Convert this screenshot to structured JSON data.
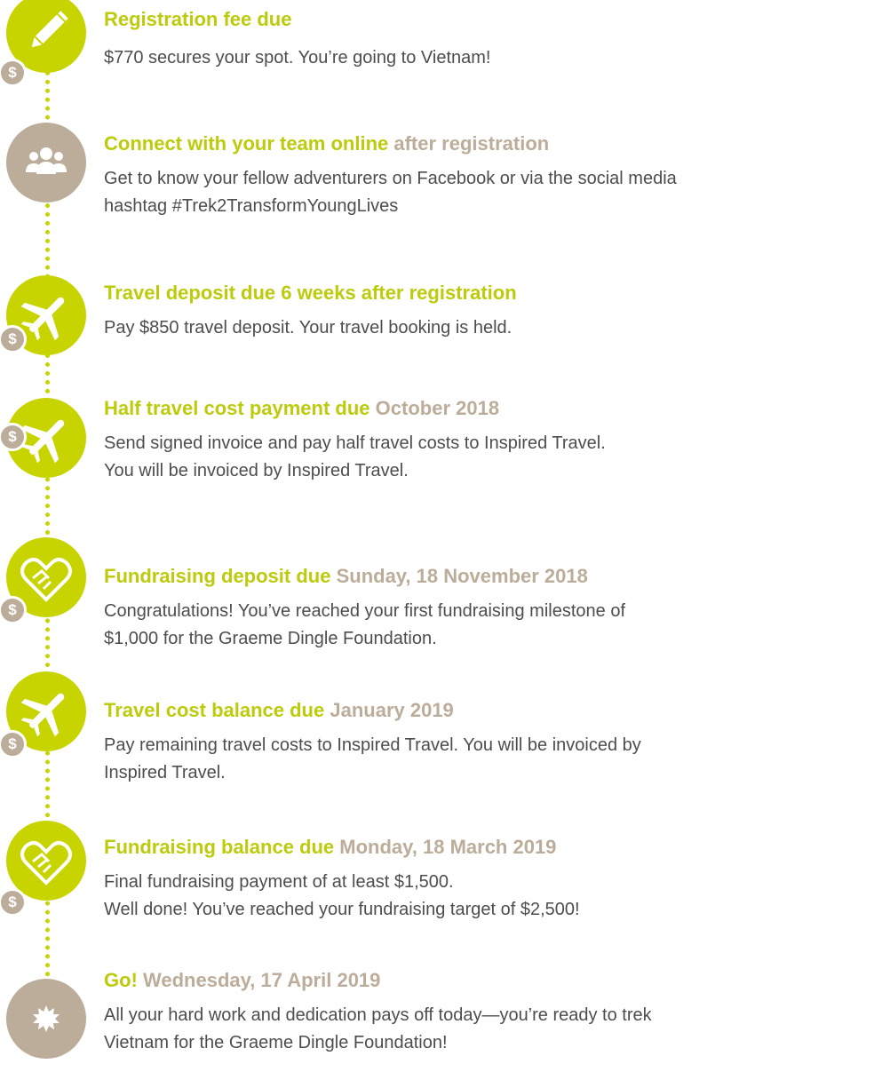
{
  "colors": {
    "accent": "#c8d400",
    "neutral": "#bcad9a",
    "text": "#4d4d4d"
  },
  "steps": [
    {
      "icon": "pencil-icon",
      "marker_color": "#c8d400",
      "coin": "$",
      "title": "Registration fee due",
      "date": "",
      "lines": [
        "$770 secures your spot. You’re going to Vietnam!"
      ]
    },
    {
      "icon": "team-icon",
      "marker_color": "#bcad9a",
      "coin": "",
      "title": "Connect with your team online",
      "date": "after registration",
      "lines": [
        "Get to know your fellow adventurers on Facebook or via the social media",
        "hashtag #Trek2TransformYoungLives"
      ]
    },
    {
      "icon": "airplane-icon",
      "marker_color": "#c8d400",
      "coin": "$",
      "title": "Travel deposit due",
      "date": "6 weeks after registration",
      "date_color": "#c8d400",
      "lines": [
        "Pay $850 travel deposit. Your travel booking is held."
      ]
    },
    {
      "icon": "airplane-icon",
      "marker_color": "#c8d400",
      "coin": "$",
      "title": "Half travel cost payment due",
      "date": "October 2018",
      "lines": [
        "Send signed invoice and pay half travel costs to Inspired Travel.",
        "You will be invoiced by Inspired Travel."
      ]
    },
    {
      "icon": "heart-handshake-icon",
      "marker_color": "#c8d400",
      "coin": "$",
      "title": "Fundraising deposit due",
      "date": "Sunday, 18 November 2018",
      "lines": [
        "Congratulations! You’ve reached your first fundraising milestone of",
        "$1,000 for the Graeme Dingle Foundation."
      ]
    },
    {
      "icon": "airplane-icon",
      "marker_color": "#c8d400",
      "coin": "$",
      "title": "Travel cost balance due",
      "date": "January 2019",
      "lines": [
        "Pay remaining travel costs to Inspired Travel. You will be invoiced by",
        "Inspired Travel."
      ]
    },
    {
      "icon": "heart-handshake-icon",
      "marker_color": "#c8d400",
      "coin": "$",
      "title": "Fundraising balance due",
      "date": "Monday, 18 March 2019",
      "lines": [
        "Final fundraising payment of at least $1,500.",
        "Well done! You’ve reached your fundraising target of $2,500!"
      ]
    },
    {
      "icon": "starburst-icon",
      "marker_color": "#bcad9a",
      "coin": "",
      "title": "Go!",
      "date": "Wednesday, 17 April 2019",
      "lines": [
        "All your hard work and dedication pays off today—you’re ready to trek",
        "Vietnam for the Graeme Dingle Foundation!"
      ]
    }
  ]
}
